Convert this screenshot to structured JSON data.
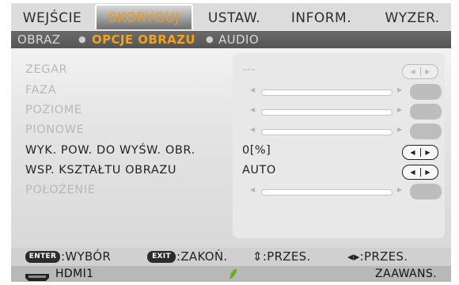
{
  "tabs": [
    "WEJŚCIE",
    "SKORYGUJ",
    "USTAW.",
    "INFORM.",
    "WYZER."
  ],
  "active_tab": 1,
  "subtabs": [
    "OBRAZ",
    "OPCJE OBRAZU",
    "AUDIO"
  ],
  "active_subtab": 1,
  "rows": [
    {
      "label": "ZEGAR",
      "enabled": false,
      "value": "---",
      "control": "pill"
    },
    {
      "label": "FAZA",
      "enabled": false,
      "control": "slider"
    },
    {
      "label": "POZIOME",
      "enabled": false,
      "control": "slider"
    },
    {
      "label": "PIONOWE",
      "enabled": false,
      "control": "slider"
    },
    {
      "label": "WYK. POW. DO WYŚW. OBR.",
      "enabled": true,
      "value": "0[%]",
      "control": "pill"
    },
    {
      "label": "WSP. KSZTAŁTU OBRAZU",
      "enabled": true,
      "value": "AUTO",
      "control": "pill"
    },
    {
      "label": "POŁOŻENIE",
      "enabled": false,
      "control": "slider"
    }
  ],
  "help": {
    "enter_key": "ENTER",
    "enter_text": ":WYBÓR",
    "exit_key": "EXIT",
    "exit_text": ":ZAKOŃ.",
    "updown_text": "⇕:PRZES.",
    "leftright_text": "◂▸:PRZES."
  },
  "status": {
    "source_icon": "hdmi-connector-icon",
    "source": "HDMI1",
    "eco_icon": "leaf-icon",
    "mode": "ZAAWANS."
  },
  "colors": {
    "accent": "#f39a1b",
    "eco_leaf": "#7ab83a"
  }
}
